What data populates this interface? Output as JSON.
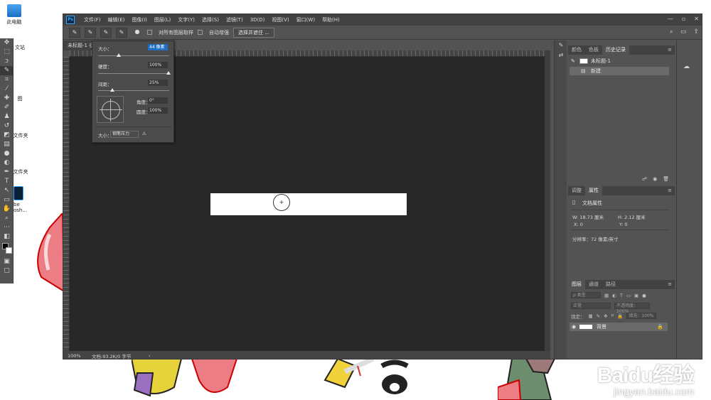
{
  "desktop": {
    "icons": [
      "此电脑",
      "文站",
      "图",
      "文件夹",
      "文件夹",
      "be",
      "osh..."
    ]
  },
  "menubar": {
    "logo": "Ps",
    "items": [
      "文件(F)",
      "编辑(E)",
      "图像(I)",
      "图层(L)",
      "文字(Y)",
      "选择(S)",
      "滤镜(T)",
      "3D(D)",
      "视图(V)",
      "窗口(W)",
      "帮助(H)"
    ],
    "controls": [
      "—",
      "▫",
      "✕"
    ]
  },
  "options": {
    "sample_all_layers": "对所有图层取样",
    "auto_enhance": "自动增强",
    "select_subject": "选择并遮住 ..."
  },
  "document": {
    "tab_label": "未标题-1 @",
    "zoom": "100%",
    "doc_info": "文档:93.2K/0 字节",
    "cursor_glyph": "+"
  },
  "brush_popup": {
    "size_label": "大小：",
    "size_value": "44 像素",
    "hardness_label": "硬度：",
    "hardness_value": "100%",
    "spacing_label": "间距：",
    "spacing_value": "25%",
    "angle_label": "角度：",
    "angle_value": "0°",
    "roundness_label": "圆度：",
    "roundness_value": "100%",
    "size_ctrl_label": "大小：",
    "size_ctrl_value": "钢笔压力"
  },
  "history_panel": {
    "tabs": [
      "颜色",
      "色板",
      "历史记录"
    ],
    "snapshot": "未标题-1",
    "step": "新建"
  },
  "properties_panel": {
    "tabs": [
      "调整",
      "属性"
    ],
    "title": "文档属性",
    "w": "W:  18.73 厘米",
    "h": "H:  2.12 厘米",
    "x": "X:  0",
    "y": "Y:  0",
    "resolution": "分辨率：72 像素/英寸"
  },
  "layers_panel": {
    "tabs": [
      "图层",
      "通道",
      "路径"
    ],
    "kind_label": "ρ 类型",
    "blend_mode": "正常",
    "opacity_label": "不透明度：100%",
    "lock_label": "锁定：",
    "fill_label": "填充：100%",
    "layer_name": "背景"
  },
  "watermark": {
    "brand": "Baidu经验",
    "url": "jingyan.baidu.com"
  }
}
